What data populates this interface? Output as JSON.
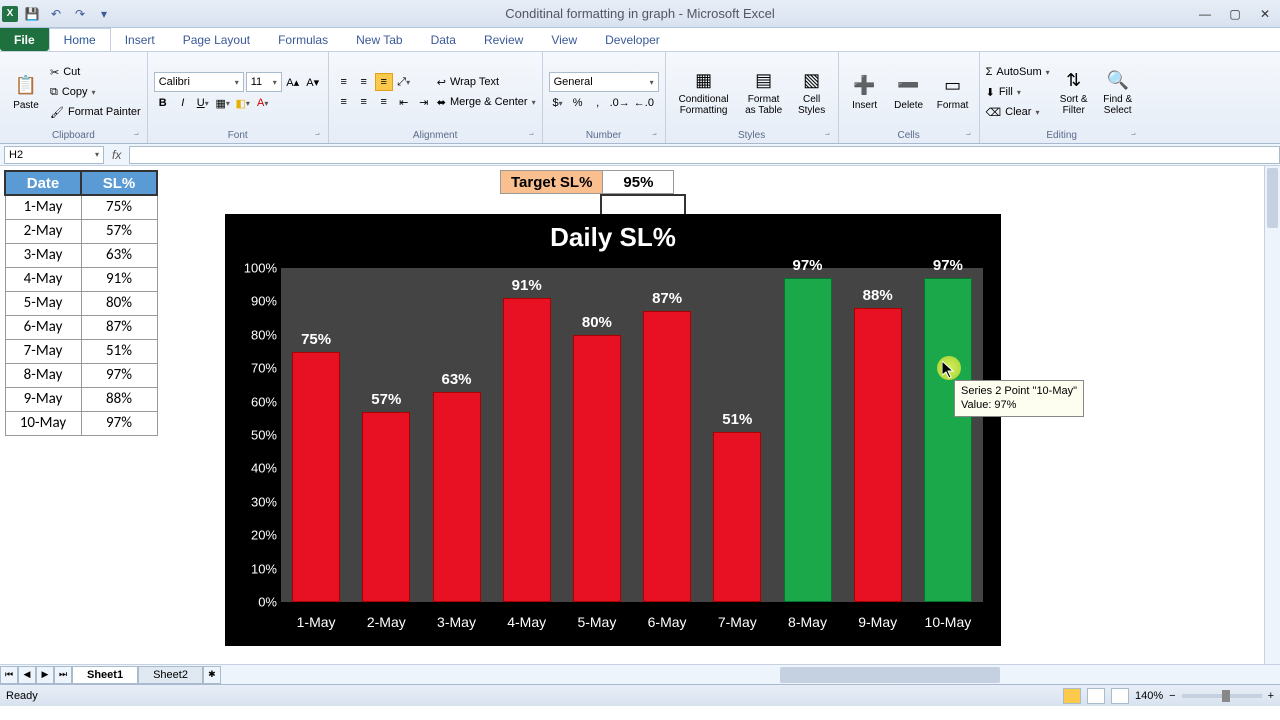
{
  "window": {
    "title": "Conditinal formatting in graph - Microsoft Excel"
  },
  "ribbon": {
    "tabs": [
      "File",
      "Home",
      "Insert",
      "Page Layout",
      "Formulas",
      "New Tab",
      "Data",
      "Review",
      "View",
      "Developer"
    ],
    "active_tab": "Home",
    "clipboard": {
      "paste": "Paste",
      "cut": "Cut",
      "copy": "Copy",
      "painter": "Format Painter",
      "group": "Clipboard"
    },
    "font": {
      "name": "Calibri",
      "size": "11",
      "group": "Font"
    },
    "alignment": {
      "wrap": "Wrap Text",
      "merge": "Merge & Center",
      "group": "Alignment"
    },
    "number": {
      "format": "General",
      "group": "Number"
    },
    "styles": {
      "cf": "Conditional\nFormatting",
      "fat": "Format\nas Table",
      "cs": "Cell\nStyles",
      "group": "Styles"
    },
    "cells": {
      "insert": "Insert",
      "delete": "Delete",
      "format": "Format",
      "group": "Cells"
    },
    "editing": {
      "autosum": "AutoSum",
      "fill": "Fill",
      "clear": "Clear",
      "sort": "Sort &\nFilter",
      "find": "Find &\nSelect",
      "group": "Editing"
    }
  },
  "formula_bar": {
    "name_box": "H2",
    "formula": ""
  },
  "table": {
    "headers": [
      "Date",
      "SL%"
    ],
    "rows": [
      [
        "1-May",
        "75%"
      ],
      [
        "2-May",
        "57%"
      ],
      [
        "3-May",
        "63%"
      ],
      [
        "4-May",
        "91%"
      ],
      [
        "5-May",
        "80%"
      ],
      [
        "6-May",
        "87%"
      ],
      [
        "7-May",
        "51%"
      ],
      [
        "8-May",
        "97%"
      ],
      [
        "9-May",
        "88%"
      ],
      [
        "10-May",
        "97%"
      ]
    ]
  },
  "target": {
    "label": "Target SL%",
    "value": "95%"
  },
  "chart_data": {
    "type": "bar",
    "title": "Daily SL%",
    "categories": [
      "1-May",
      "2-May",
      "3-May",
      "4-May",
      "5-May",
      "6-May",
      "7-May",
      "8-May",
      "9-May",
      "10-May"
    ],
    "values": [
      75,
      57,
      63,
      91,
      80,
      87,
      51,
      97,
      88,
      97
    ],
    "target": 95,
    "ylabel": "",
    "xlabel": "",
    "ylim": [
      0,
      100
    ],
    "y_ticks": [
      0,
      10,
      20,
      30,
      40,
      50,
      60,
      70,
      80,
      90,
      100
    ],
    "colors_above_target": "#1ba84a",
    "colors_below_target": "#e81123"
  },
  "tooltip": {
    "line1": "Series 2 Point \"10-May\"",
    "line2": "Value: 97%"
  },
  "sheets": {
    "tabs": [
      "Sheet1",
      "Sheet2"
    ],
    "active": "Sheet1"
  },
  "status": {
    "left": "Ready",
    "zoom": "140%"
  }
}
